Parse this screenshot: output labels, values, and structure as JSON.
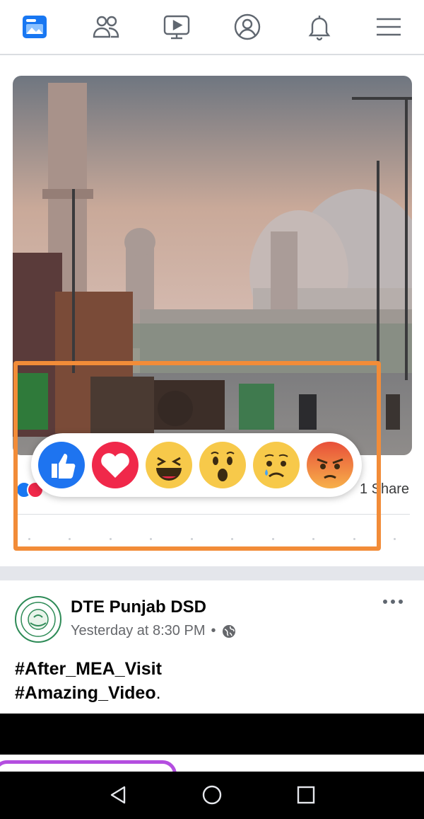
{
  "top_nav": {
    "items": [
      {
        "name": "news-feed-icon"
      },
      {
        "name": "friends-icon"
      },
      {
        "name": "watch-icon"
      },
      {
        "name": "profile-icon"
      },
      {
        "name": "notifications-icon"
      },
      {
        "name": "menu-icon"
      }
    ],
    "active_color": "#1877f2",
    "inactive_color": "#606770"
  },
  "post1": {
    "image_description": "",
    "share_count": "1 Share"
  },
  "reactions": [
    {
      "name": "like-reaction"
    },
    {
      "name": "love-reaction"
    },
    {
      "name": "haha-reaction"
    },
    {
      "name": "wow-reaction"
    },
    {
      "name": "sad-reaction"
    },
    {
      "name": "angry-reaction"
    }
  ],
  "highlight_color": "#f28c38",
  "post2": {
    "author": "DTE Punjab DSD",
    "timestamp": "Yesterday at 8:30 PM",
    "separator": "•",
    "lines": [
      "#After_MEA_Visit",
      "#Amazing_Video"
    ],
    "line2_suffix": "."
  },
  "system_nav": {
    "back": "back-icon",
    "home": "home-icon",
    "recents": "recents-icon"
  }
}
